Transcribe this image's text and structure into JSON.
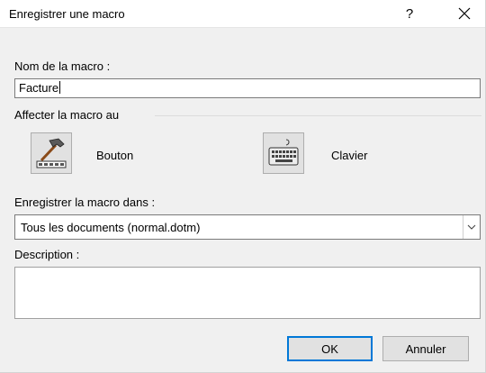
{
  "window": {
    "title": "Enregistrer une macro",
    "help_label": "?",
    "close_label": "✕"
  },
  "name_section": {
    "label": "Nom de la macro :",
    "value": "Facture"
  },
  "assign_section": {
    "label": "Affecter la macro au",
    "button_label": "Bouton",
    "keyboard_label": "Clavier",
    "button_icon": "hammer-toolbar-icon",
    "keyboard_icon": "keyboard-icon"
  },
  "store_section": {
    "label": "Enregistrer la macro dans :",
    "selected": "Tous les documents (normal.dotm)"
  },
  "description_section": {
    "label": "Description :",
    "value": ""
  },
  "actions": {
    "ok_label": "OK",
    "cancel_label": "Annuler"
  },
  "colors": {
    "accent": "#0078d7",
    "dialog_bg": "#f0f0f0"
  }
}
